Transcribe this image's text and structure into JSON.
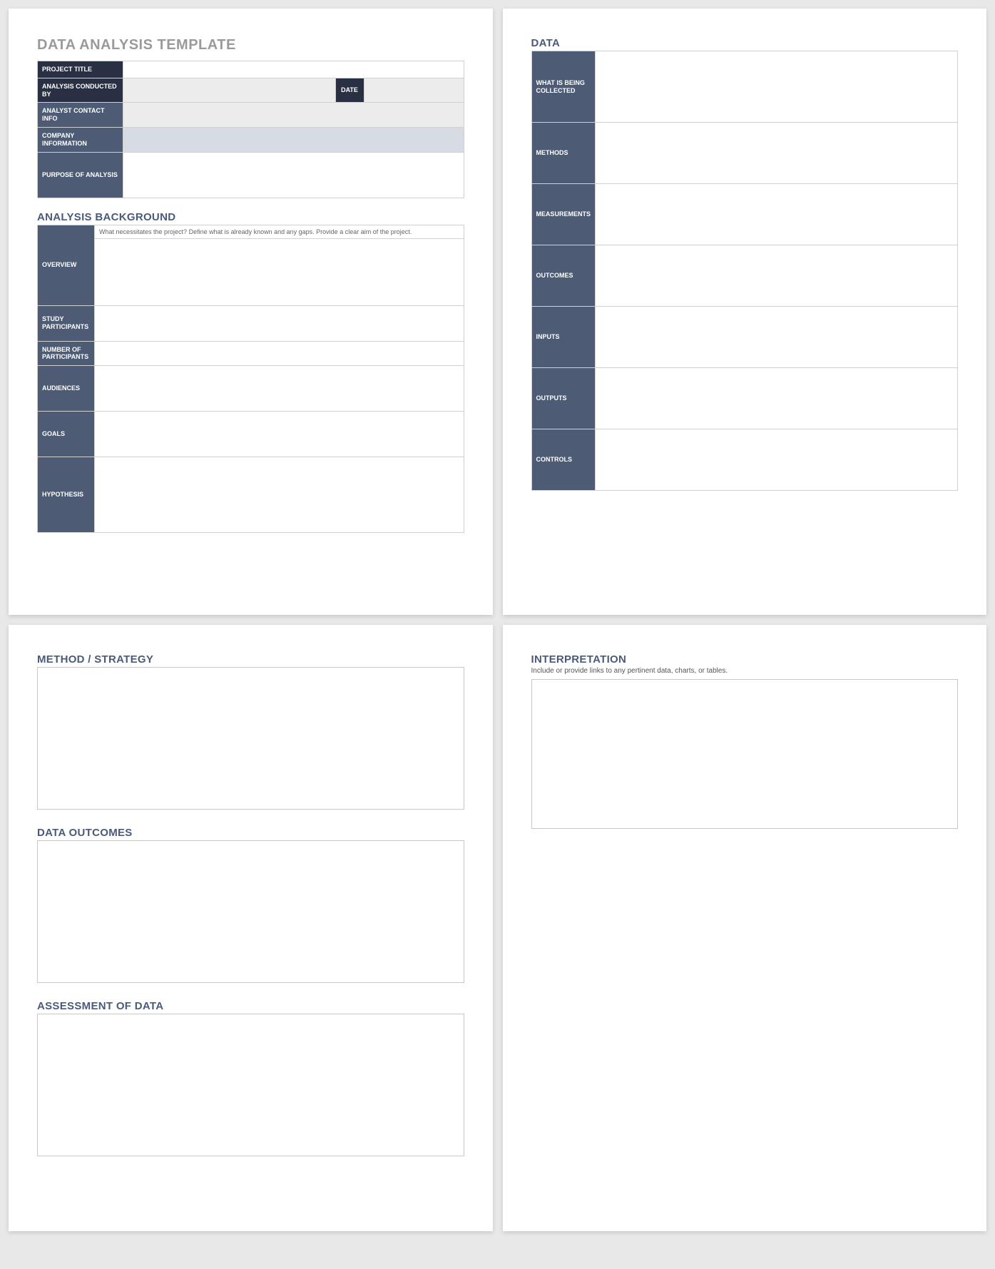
{
  "page1": {
    "title": "DATA ANALYSIS TEMPLATE",
    "header_rows": {
      "project_title": "PROJECT TITLE",
      "analysis_conducted_by": "ANALYSIS CONDUCTED BY",
      "date": "DATE",
      "analyst_contact_info": "ANALYST CONTACT INFO",
      "company_information": "COMPANY INFORMATION",
      "purpose_of_analysis": "PURPOSE OF ANALYSIS"
    },
    "background": {
      "title": "ANALYSIS BACKGROUND",
      "overview": "OVERVIEW",
      "overview_hint": "What necessitates the project? Define what is already known and any gaps. Provide a clear aim of the project.",
      "study_participants": "STUDY PARTICIPANTS",
      "number_of_participants": "NUMBER OF PARTICIPANTS",
      "audiences": "AUDIENCES",
      "goals": "GOALS",
      "hypothesis": "HYPOTHESIS"
    }
  },
  "page2": {
    "title": "DATA",
    "rows": {
      "what_collected": "WHAT IS BEING COLLECTED",
      "methods": "METHODS",
      "measurements": "MEASUREMENTS",
      "outcomes": "OUTCOMES",
      "inputs": "INPUTS",
      "outputs": "OUTPUTS",
      "controls": "CONTROLS"
    }
  },
  "page3": {
    "method_strategy": "METHOD / STRATEGY",
    "data_outcomes": "DATA OUTCOMES",
    "assessment_of_data": "ASSESSMENT OF DATA"
  },
  "page4": {
    "interpretation": "INTERPRETATION",
    "interpretation_sub": "Include or provide links to any pertinent data, charts, or tables."
  }
}
